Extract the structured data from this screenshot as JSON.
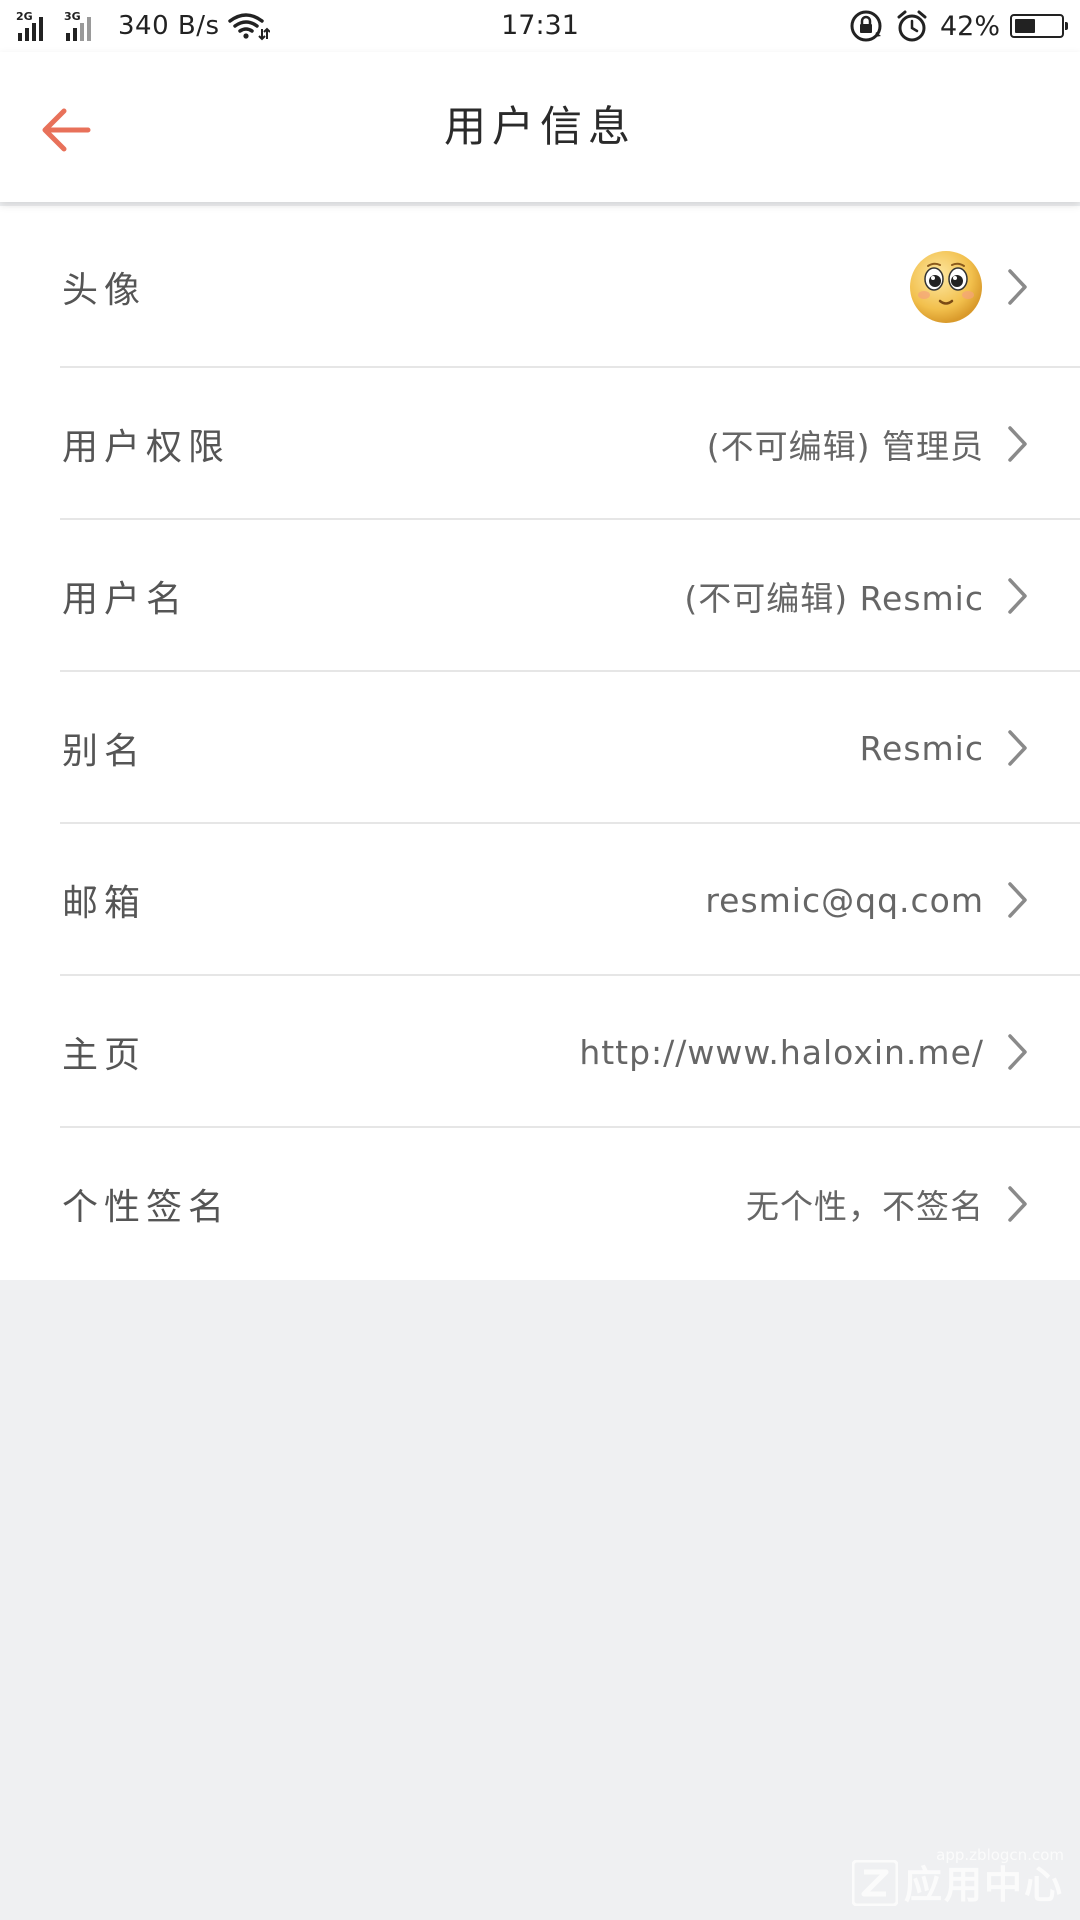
{
  "status_bar": {
    "network_1": "2G",
    "network_2": "3G",
    "speed": "340 B/s",
    "time": "17:31",
    "battery": "42%",
    "icons": [
      "signal-icon",
      "wifi-icon",
      "rotation-lock-icon",
      "alarm-icon",
      "battery-icon"
    ]
  },
  "header": {
    "back_icon": "arrow-left-icon",
    "title": "用户信息",
    "accent_color": "#e8715a"
  },
  "rows": [
    {
      "label": "头像",
      "value": "",
      "type": "avatar",
      "icon": "emoji-avatar-icon"
    },
    {
      "label": "用户权限",
      "value": "(不可编辑) 管理员"
    },
    {
      "label": "用户名",
      "value": "(不可编辑) Resmic"
    },
    {
      "label": "别名",
      "value": "Resmic"
    },
    {
      "label": "邮箱",
      "value": "resmic@qq.com"
    },
    {
      "label": "主页",
      "value": "http://www.haloxin.me/"
    },
    {
      "label": "个性签名",
      "value": "无个性，不签名"
    }
  ],
  "watermark": {
    "url": "app.zblogcn.com",
    "name": "应用中心"
  }
}
